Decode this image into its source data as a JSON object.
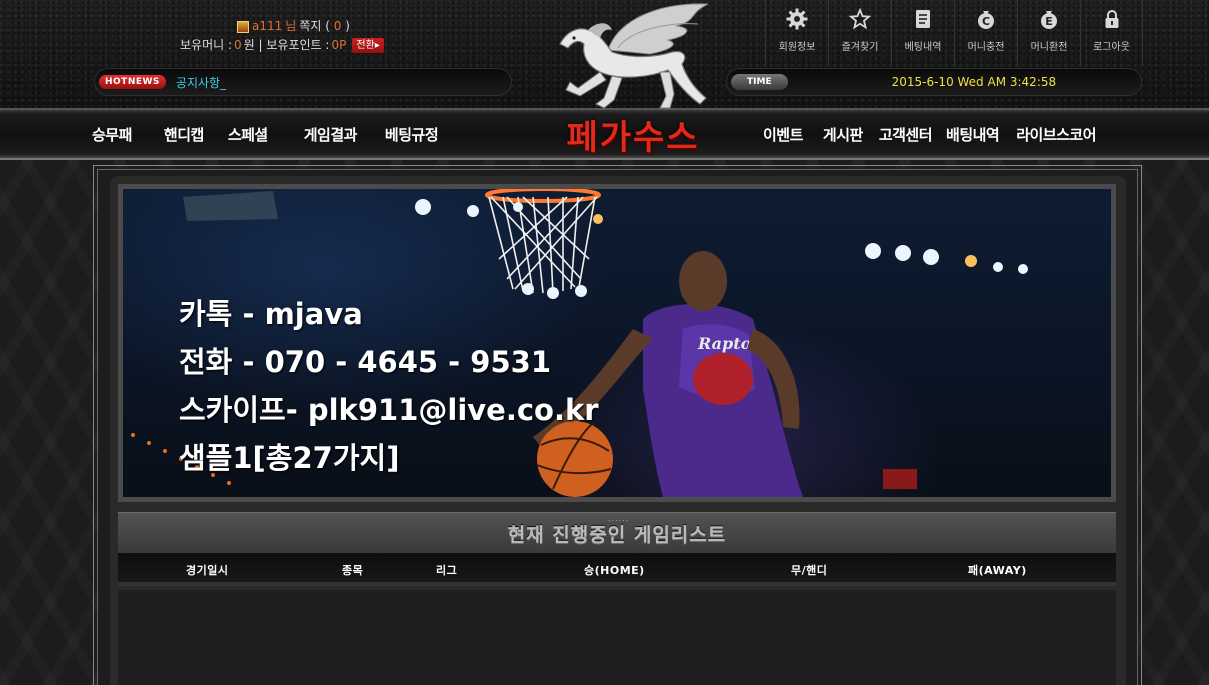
{
  "user": {
    "id": "a111",
    "suffix": "님",
    "memo_label": "쪽지 (",
    "memo_count": "0",
    "memo_close": ")",
    "money_label": "보유머니 : ",
    "money_value": "0",
    "money_unit": "원 | 보유포인트 : ",
    "point_value": "0P",
    "convert_label": "전환▸"
  },
  "hotnews": {
    "badge": "HOTNEWS",
    "text": "공지사항_"
  },
  "time": {
    "badge": "TIME",
    "value": "2015-6-10 Wed AM 3:42:58"
  },
  "top_menu": [
    {
      "label": "회원정보",
      "icon": "gear-icon"
    },
    {
      "label": "즐겨찾기",
      "icon": "star-icon"
    },
    {
      "label": "베팅내역",
      "icon": "document-icon"
    },
    {
      "label": "머니충전",
      "icon": "coin-c-icon"
    },
    {
      "label": "머니환전",
      "icon": "coin-e-icon"
    },
    {
      "label": "로그아웃",
      "icon": "lock-icon"
    }
  ],
  "logo": {
    "text": "페가수스"
  },
  "nav_left": [
    "승무패",
    "핸디캡",
    "스페셜",
    "게임결과",
    "베팅규정"
  ],
  "nav_right": [
    "이벤트",
    "게시판",
    "고객센터",
    "배팅내역",
    "라이브스코어"
  ],
  "banner": {
    "lines": [
      "카톡 - mjava",
      "전화 - 070 - 4645 - 9531",
      "스카이프- plk911@live.co.kr",
      "샘플1[총27가지]"
    ]
  },
  "gamelist": {
    "dots": "......",
    "title": "현재 진행중인 게임리스트",
    "columns": [
      "경기일시",
      "종목",
      "리그",
      "승(HOME)",
      "무/핸디",
      "패(AWAY)"
    ]
  },
  "colors": {
    "accent_red": "#e02a1a",
    "hotnews_cyan": "#40d0e0",
    "time_yellow": "#f0e040",
    "money_orange": "#e07030"
  }
}
